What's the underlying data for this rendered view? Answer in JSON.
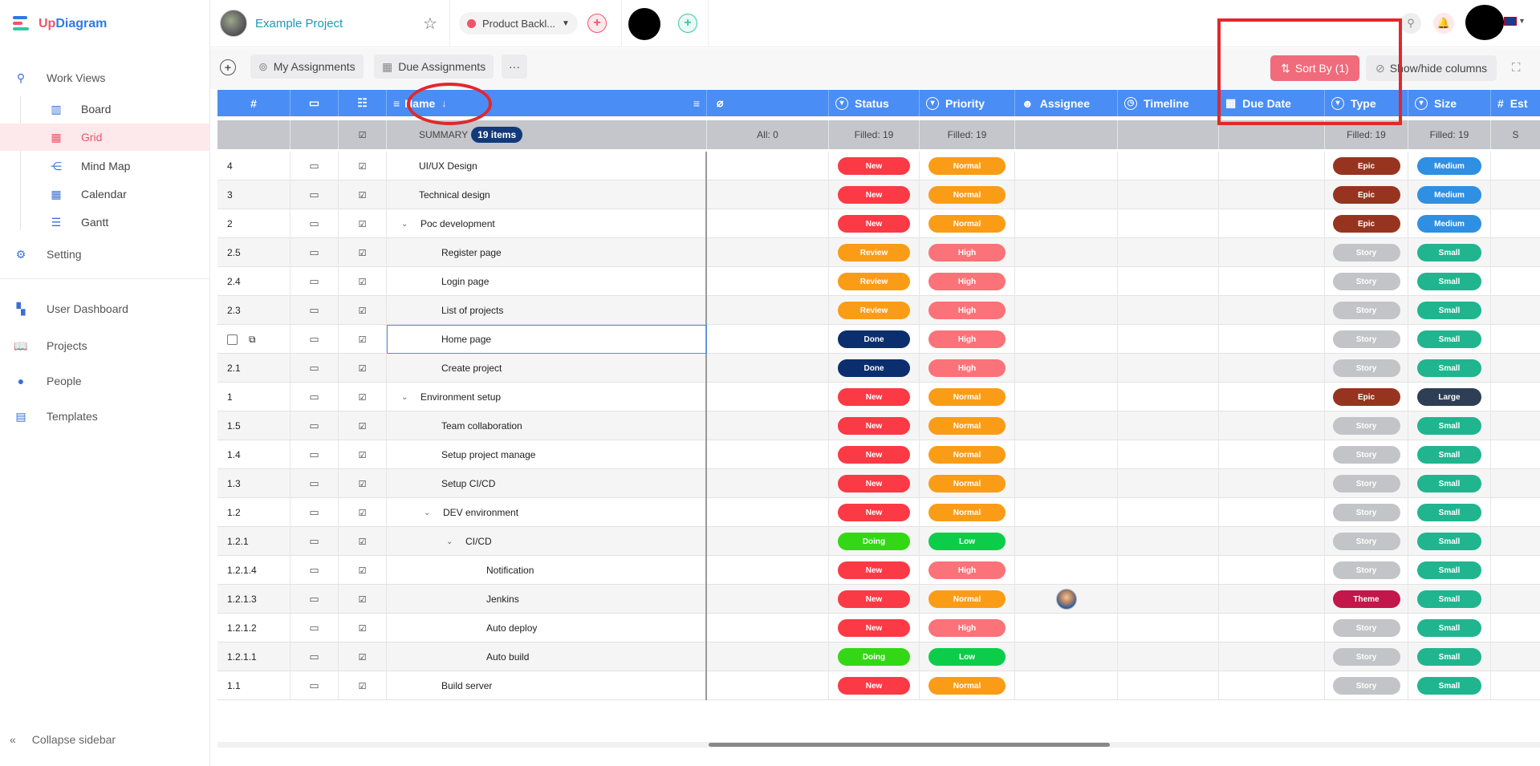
{
  "app": {
    "brand_prefix": "Up",
    "brand_suffix": "Diagram"
  },
  "sidebar": {
    "work_views": "Work Views",
    "items": [
      {
        "label": "Board",
        "icon": "board-icon"
      },
      {
        "label": "Grid",
        "icon": "grid-icon",
        "active": true
      },
      {
        "label": "Mind Map",
        "icon": "mind-map-icon"
      },
      {
        "label": "Calendar",
        "icon": "calendar-icon"
      },
      {
        "label": "Gantt",
        "icon": "gantt-icon"
      }
    ],
    "setting": "Setting",
    "user_dashboard": "User Dashboard",
    "projects": "Projects",
    "people": "People",
    "templates": "Templates",
    "collapse": "Collapse sidebar"
  },
  "topbar": {
    "project_name": "Example Project",
    "backlog": "Product Backl..."
  },
  "toolbar": {
    "my_assignments": "My Assignments",
    "due_assignments": "Due Assignments",
    "more": "···",
    "sort_by": "Sort By (1)",
    "show_hide": "Show/hide columns"
  },
  "grid": {
    "headers": {
      "num": "#",
      "name": "Name",
      "sort_indicator": "↓",
      "status": "Status",
      "priority": "Priority",
      "assignee": "Assignee",
      "timeline": "Timeline",
      "due_date": "Due Date",
      "type": "Type",
      "size": "Size",
      "est": "Est"
    },
    "summary": {
      "label": "SUMMARY",
      "count": "19 items",
      "attach": "All: 0",
      "status": "Filled: 19",
      "priority": "Filled: 19",
      "type": "Filled: 19",
      "size": "Filled: 19",
      "est": "S"
    },
    "rows": [
      {
        "num": "4",
        "name": "UI/UX Design",
        "indent": 0,
        "caret": false,
        "status": "New",
        "priority": "Normal",
        "type": "Epic",
        "size": "Medium"
      },
      {
        "num": "3",
        "name": "Technical design",
        "indent": 0,
        "caret": false,
        "status": "New",
        "priority": "Normal",
        "type": "Epic",
        "size": "Medium"
      },
      {
        "num": "2",
        "name": "Poc development",
        "indent": 0,
        "caret": true,
        "status": "New",
        "priority": "Normal",
        "type": "Epic",
        "size": "Medium"
      },
      {
        "num": "2.5",
        "name": "Register page",
        "indent": 1,
        "caret": false,
        "status": "Review",
        "priority": "High",
        "type": "Story",
        "size": "Small"
      },
      {
        "num": "2.4",
        "name": "Login page",
        "indent": 1,
        "caret": false,
        "status": "Review",
        "priority": "High",
        "type": "Story",
        "size": "Small"
      },
      {
        "num": "2.3",
        "name": "List of projects",
        "indent": 1,
        "caret": false,
        "status": "Review",
        "priority": "High",
        "type": "Story",
        "size": "Small"
      },
      {
        "num": "",
        "name": "Home page",
        "indent": 1,
        "caret": false,
        "status": "Done",
        "priority": "High",
        "type": "Story",
        "size": "Small",
        "selected": true
      },
      {
        "num": "2.1",
        "name": "Create project",
        "indent": 1,
        "caret": false,
        "status": "Done",
        "priority": "High",
        "type": "Story",
        "size": "Small"
      },
      {
        "num": "1",
        "name": "Environment setup",
        "indent": 0,
        "caret": true,
        "status": "New",
        "priority": "Normal",
        "type": "Epic",
        "size": "Large"
      },
      {
        "num": "1.5",
        "name": "Team collaboration",
        "indent": 1,
        "caret": false,
        "status": "New",
        "priority": "Normal",
        "type": "Story",
        "size": "Small"
      },
      {
        "num": "1.4",
        "name": "Setup project manage",
        "indent": 1,
        "caret": false,
        "status": "New",
        "priority": "Normal",
        "type": "Story",
        "size": "Small"
      },
      {
        "num": "1.3",
        "name": "Setup CI/CD",
        "indent": 1,
        "caret": false,
        "status": "New",
        "priority": "Normal",
        "type": "Story",
        "size": "Small"
      },
      {
        "num": "1.2",
        "name": "DEV environment",
        "indent": 1,
        "caret": true,
        "status": "New",
        "priority": "Normal",
        "type": "Story",
        "size": "Small"
      },
      {
        "num": "1.2.1",
        "name": "CI/CD",
        "indent": 2,
        "caret": true,
        "status": "Doing",
        "priority": "Low",
        "type": "Story",
        "size": "Small"
      },
      {
        "num": "1.2.1.4",
        "name": "Notification",
        "indent": 3,
        "caret": false,
        "status": "New",
        "priority": "High",
        "type": "Story",
        "size": "Small"
      },
      {
        "num": "1.2.1.3",
        "name": "Jenkins",
        "indent": 3,
        "caret": false,
        "status": "New",
        "priority": "Normal",
        "type": "Theme",
        "size": "Small",
        "assignee": true
      },
      {
        "num": "1.2.1.2",
        "name": "Auto deploy",
        "indent": 3,
        "caret": false,
        "status": "New",
        "priority": "High",
        "type": "Story",
        "size": "Small"
      },
      {
        "num": "1.2.1.1",
        "name": "Auto build",
        "indent": 3,
        "caret": false,
        "status": "Doing",
        "priority": "Low",
        "type": "Story",
        "size": "Small"
      },
      {
        "num": "1.1",
        "name": "Build server",
        "indent": 1,
        "caret": false,
        "status": "New",
        "priority": "Normal",
        "type": "Story",
        "size": "Small"
      }
    ]
  },
  "colors": {
    "New": "#fb3a45",
    "Review": "#fb9c17",
    "Done": "#0b2f6e",
    "Doing": "#33d716",
    "Normal": "#fb9c17",
    "High": "#fb7278",
    "Low": "#0ccd49",
    "Epic": "#97341f",
    "Story": "#c3c4c8",
    "Theme": "#c3164a",
    "Medium": "#2f8fe3",
    "Small": "#20b58f",
    "Large": "#2e3e55",
    "accent": "#4a8df4",
    "brand": "#f0536b"
  }
}
